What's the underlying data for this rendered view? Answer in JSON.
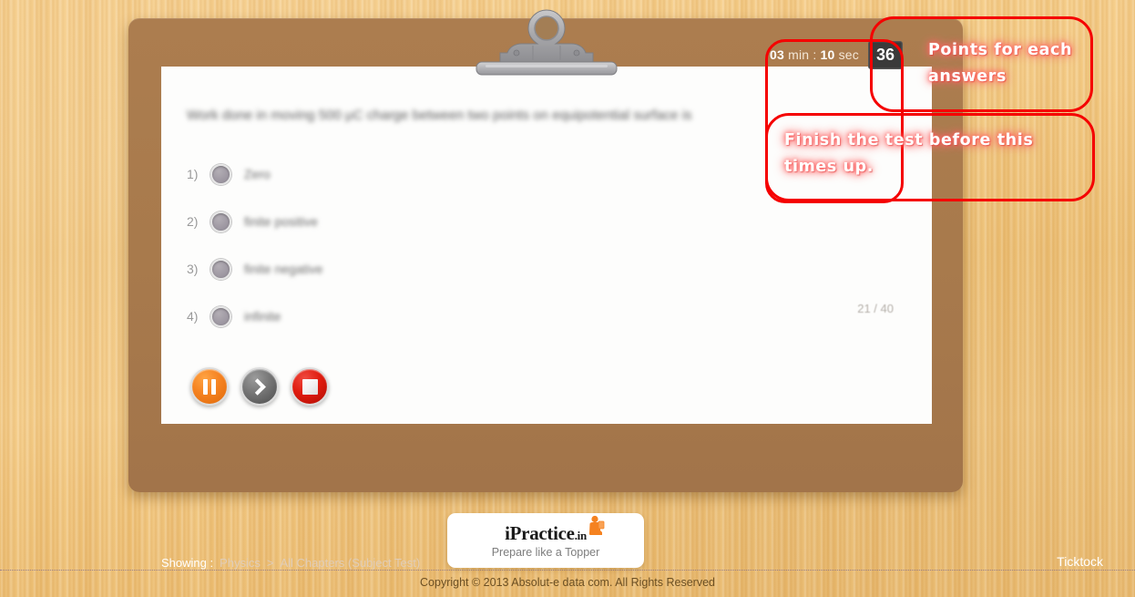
{
  "app": {
    "brand_name": "iPractice",
    "brand_tld": ".in",
    "tagline": "Prepare like a Topper",
    "copyright": "Copyright © 2013 Absolut-e data com. All Rights Reserved"
  },
  "colors": {
    "clipboard_brown": "#a87a4c",
    "paper_white": "#fdfdfc",
    "wood_light": "#f3c87e",
    "accent_orange": "#f58220",
    "stop_red": "#e01c0f",
    "annotation_red": "#f50000",
    "badge_dark": "#3a3a3a"
  },
  "timer": {
    "minutes": "03",
    "minutes_unit": "min",
    "separator": ":",
    "seconds": "10",
    "seconds_unit": "sec",
    "full_text": "03 min : 10 sec"
  },
  "score": {
    "points": "36"
  },
  "question": {
    "text": "Work done in moving 500 μC charge between two points on equipotential surface is",
    "counter": "21 / 40",
    "current": "21",
    "total": "40",
    "options": [
      {
        "number": "1)",
        "label": "Zero"
      },
      {
        "number": "2)",
        "label": "finite positive"
      },
      {
        "number": "3)",
        "label": "finite negative"
      },
      {
        "number": "4)",
        "label": "infinite"
      }
    ]
  },
  "controls": [
    {
      "name": "pause",
      "icon": "pause-icon",
      "title": "Pause"
    },
    {
      "name": "next",
      "icon": "chevron-right-icon",
      "title": "Next"
    },
    {
      "name": "stop",
      "icon": "stop-icon",
      "title": "Stop"
    }
  ],
  "footer": {
    "showing_label": "Showing :",
    "subject": "Physics",
    "separator": ">",
    "scope": "All Chapters (Subject Test)",
    "mode_label": "Ticktock"
  },
  "annotations": [
    {
      "id": "points-callout",
      "text": "Points for each answers",
      "line1": "Points for each",
      "line2": "answers"
    },
    {
      "id": "timer-callout",
      "text": "Finish the test before this times up.",
      "line1": "Finish the test before this",
      "line2": "times up."
    }
  ]
}
